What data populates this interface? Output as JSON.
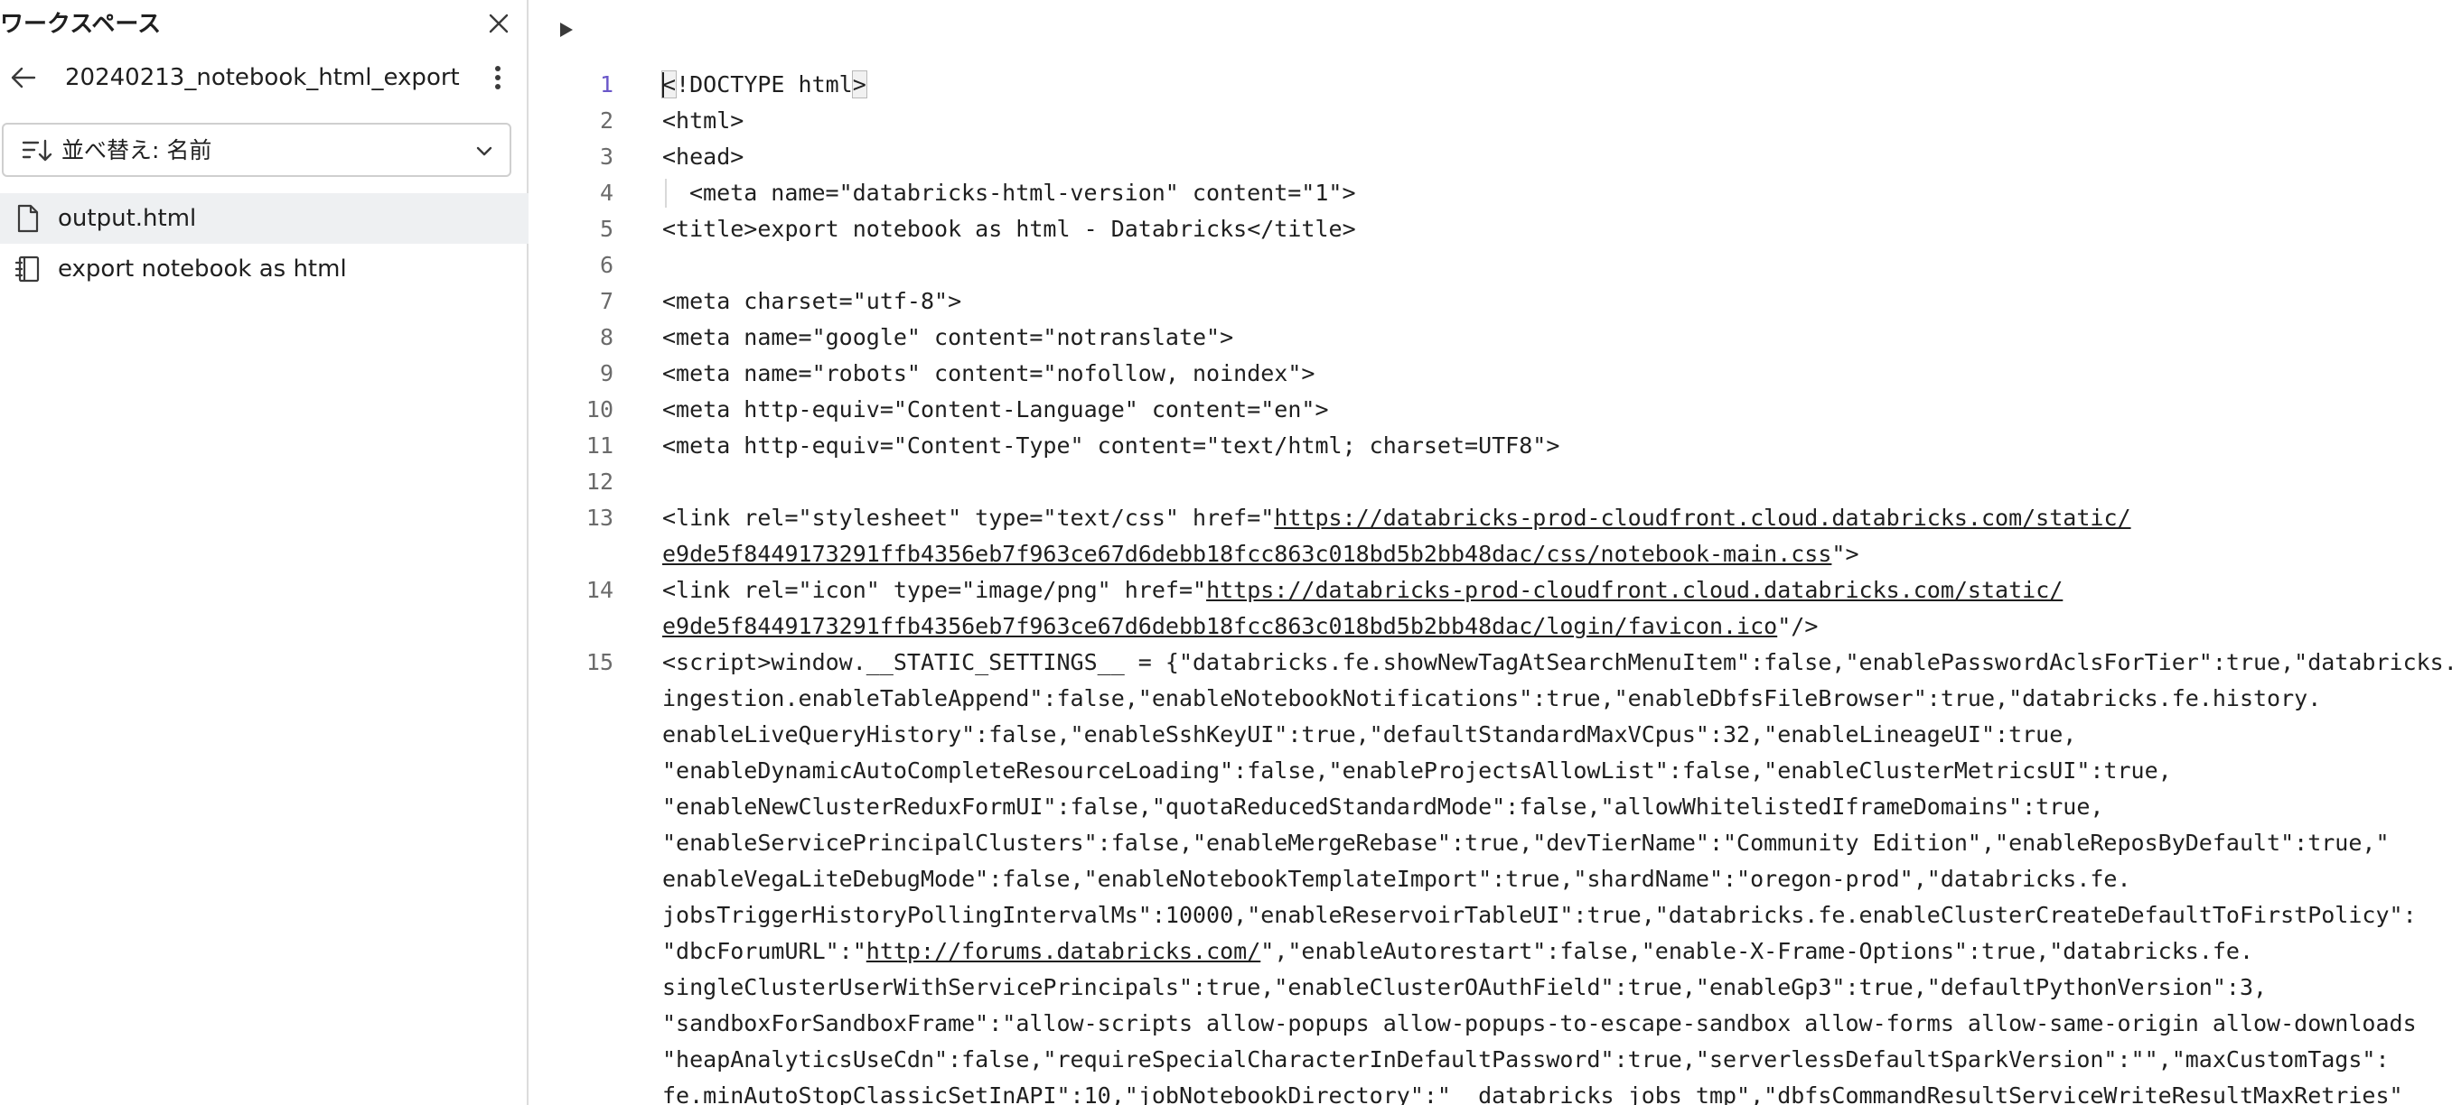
{
  "sidebar": {
    "title": "ワークスペース",
    "folder_name": "20240213_notebook_html_export",
    "sort_label": "並べ替え: 名前",
    "items": [
      {
        "label": "output.html",
        "icon": "file-icon",
        "selected": true
      },
      {
        "label": "export notebook as html",
        "icon": "notebook-icon",
        "selected": false
      }
    ]
  },
  "editor": {
    "lines": [
      {
        "num": "1",
        "text": "!DOCTYPE html"
      },
      {
        "num": "2",
        "text": "<html>"
      },
      {
        "num": "3",
        "text": "<head>"
      },
      {
        "num": "4",
        "text": "<meta name=\"databricks-html-version\" content=\"1\">"
      },
      {
        "num": "5",
        "text": "<title>export notebook as html - Databricks</title>"
      },
      {
        "num": "6",
        "text": ""
      },
      {
        "num": "7",
        "text": "<meta charset=\"utf-8\">"
      },
      {
        "num": "8",
        "text": "<meta name=\"google\" content=\"notranslate\">"
      },
      {
        "num": "9",
        "text": "<meta name=\"robots\" content=\"nofollow, noindex\">"
      },
      {
        "num": "10",
        "text": "<meta http-equiv=\"Content-Language\" content=\"en\">"
      },
      {
        "num": "11",
        "text": "<meta http-equiv=\"Content-Type\" content=\"text/html; charset=UTF8\">"
      },
      {
        "num": "12",
        "text": ""
      },
      {
        "num": "13",
        "pre": "<link rel=\"stylesheet\" type=\"text/css\" href=\"",
        "link": "https://databricks-prod-cloudfront.cloud.databricks.com/static/",
        "wrap_link": "e9de5f8449173291ffb4356eb7f963ce67d6debb18fcc863c018bd5b2bb48dac/css/notebook-main.css",
        "post": "\">"
      },
      {
        "num": "14",
        "pre": "<link rel=\"icon\" type=\"image/png\" href=\"",
        "link": "https://databricks-prod-cloudfront.cloud.databricks.com/static/",
        "wrap_link": "e9de5f8449173291ffb4356eb7f963ce67d6debb18fcc863c018bd5b2bb48dac/login/favicon.ico",
        "post": "\"/>"
      },
      {
        "num": "15",
        "wrapped": [
          "<script>window.__STATIC_SETTINGS__ = {\"databricks.fe.showNewTagAtSearchMenuItem\":false,\"enablePasswordAclsForTier\":true,\"databricks.fe.",
          "ingestion.enableTableAppend\":false,\"enableNotebookNotifications\":true,\"enableDbfsFileBrowser\":true,\"databricks.fe.history.",
          "enableLiveQueryHistory\":false,\"enableSshKeyUI\":true,\"defaultStandardMaxVCpus\":32,\"enableLineageUI\":true,",
          "\"enableDynamicAutoCompleteResourceLoading\":false,\"enableProjectsAllowList\":false,\"enableClusterMetricsUI\":true,",
          "\"enableNewClusterReduxFormUI\":false,\"quotaReducedStandardMode\":false,\"allowWhitelistedIframeDomains\":true,",
          "\"enableServicePrincipalClusters\":false,\"enableMergeRebase\":true,\"devTierName\":\"Community Edition\",\"enableReposByDefault\":true,\"",
          "enableVegaLiteDebugMode\":false,\"enableNotebookTemplateImport\":true,\"shardName\":\"oregon-prod\",\"databricks.fe.",
          "jobsTriggerHistoryPollingIntervalMs\":10000,\"enableReservoirTableUI\":true,\"databricks.fe.enableClusterCreateDefaultToFirstPolicy\":",
          "\"dbcForumURL\":\"",
          "singleClusterUserWithServicePrincipals\":true,\"enableClusterOAuthField\":true,\"enableGp3\":true,\"defaultPythonVersion\":3,",
          "\"sandboxForSandboxFrame\":\"allow-scripts allow-popups allow-popups-to-escape-sandbox allow-forms allow-same-origin allow-downloads",
          "\"heapAnalyticsUseCdn\":false,\"requireSpecialCharacterInDefaultPassword\":true,\"serverlessDefaultSparkVersion\":\"\",\"maxCustomTags\":",
          "fe.minAutoStopClassicSetInAPI\":10,\"jobNotebookDirectory\":\"__databricks_jobs_tmp\",\"dbfsCommandResultServiceWriteResultMaxRetries\""
        ],
        "forum_link": "http://forums.databricks.com/",
        "forum_post": "\",\"enableAutorestart\":false,\"enable-X-Frame-Options\":true,\"databricks.fe."
      }
    ]
  }
}
